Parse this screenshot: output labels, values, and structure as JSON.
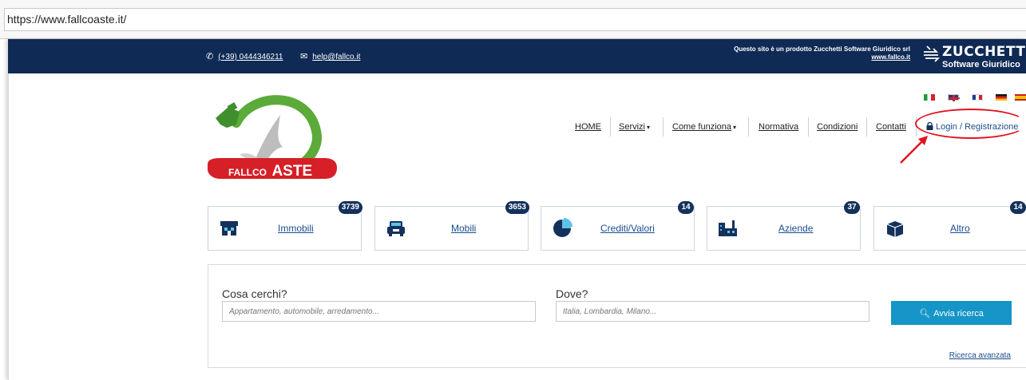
{
  "browser": {
    "url": "https://www.fallcoaste.it/"
  },
  "topbar": {
    "phone": "(+39) 0444346211",
    "email": "help@fallco.it",
    "promo_line1": "Questo sito è un prodotto Zucchetti Software Giuridico srl",
    "promo_link": "www.fallco.it",
    "brand_name": "ZUCCHETTI",
    "brand_sub": "Software Giuridico"
  },
  "logo": {
    "text_small": "FALLCO",
    "text_big": "ASTE"
  },
  "languages": [
    "it",
    "en",
    "fr",
    "de",
    "es"
  ],
  "nav": {
    "home": "HOME",
    "servizi": "Servizi",
    "come_funziona": "Come funziona",
    "normativa": "Normativa",
    "condizioni": "Condizioni",
    "contatti": "Contatti",
    "login": "Login / Registrazione"
  },
  "categories": [
    {
      "label": "Immobili",
      "count": "3739",
      "icon": "house-icon"
    },
    {
      "label": "Mobili",
      "count": "3653",
      "icon": "car-icon"
    },
    {
      "label": "Crediti/Valori",
      "count": "14",
      "icon": "pie-chart-icon"
    },
    {
      "label": "Aziende",
      "count": "37",
      "icon": "factory-icon"
    },
    {
      "label": "Altro",
      "count": "14",
      "icon": "box-icon"
    }
  ],
  "search": {
    "what_label": "Cosa cerchi?",
    "what_placeholder": "Appartamento, automobile, arredamento...",
    "where_label": "Dove?",
    "where_placeholder": "Italia, Lombardia, Milano...",
    "button": "Avvia ricerca",
    "advanced": "Ricerca avanzata"
  },
  "colors": {
    "topbar": "#0f2a54",
    "badge": "#14315c",
    "button": "#1595c8",
    "link": "#1b4d8c",
    "annotation": "#e0141e"
  }
}
